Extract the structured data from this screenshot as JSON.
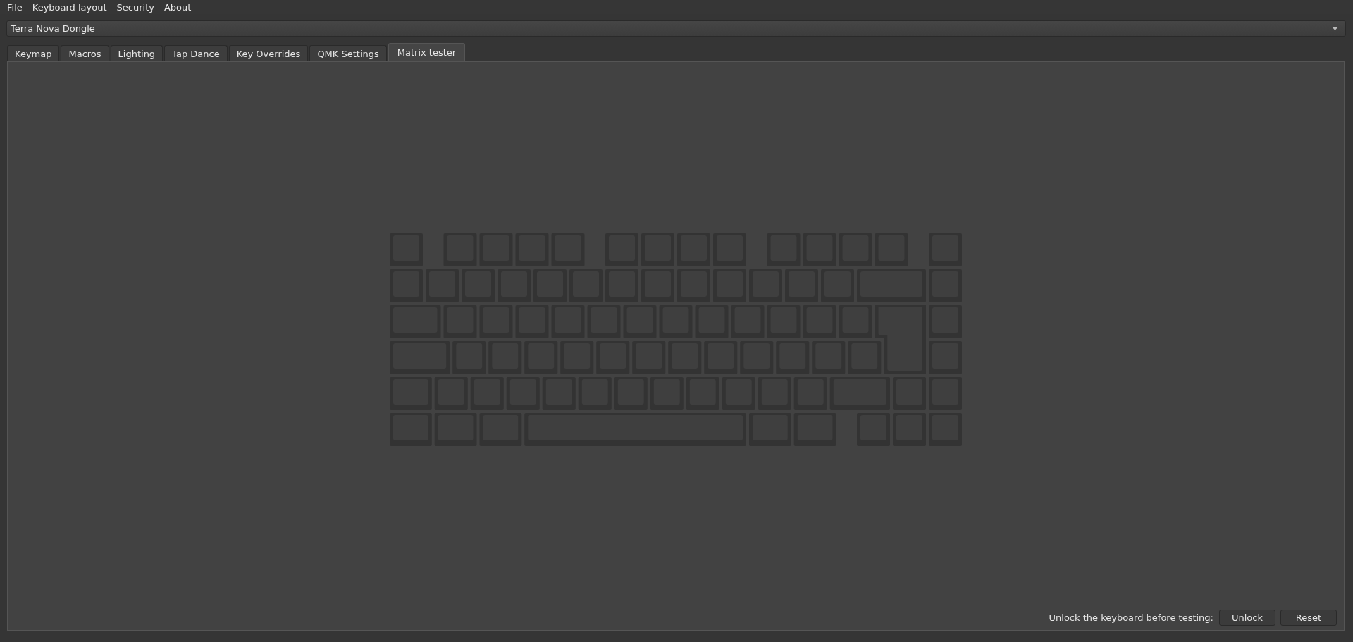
{
  "menu": [
    {
      "label": "File"
    },
    {
      "label": "Keyboard layout"
    },
    {
      "label": "Security"
    },
    {
      "label": "About"
    }
  ],
  "device_select": {
    "value": "Terra Nova Dongle"
  },
  "tabs": [
    {
      "label": "Keymap",
      "selected": false
    },
    {
      "label": "Macros",
      "selected": false
    },
    {
      "label": "Lighting",
      "selected": false
    },
    {
      "label": "Tap Dance",
      "selected": false
    },
    {
      "label": "Key Overrides",
      "selected": false
    },
    {
      "label": "QMK Settings",
      "selected": false
    },
    {
      "label": "Matrix tester",
      "selected": true
    }
  ],
  "footer": {
    "message": "Unlock the keyboard before testing:",
    "buttons": [
      {
        "label": "Unlock"
      },
      {
        "label": "Reset"
      }
    ]
  }
}
